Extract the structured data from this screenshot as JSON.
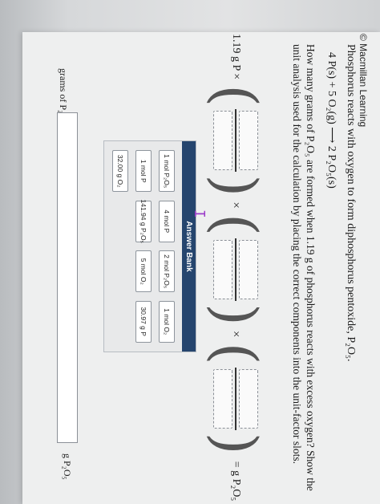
{
  "credit": "© Macmillan Learning",
  "intro": "Phosphorus reacts with oxygen to form diphosphorus pentoxide, P₂O₅.",
  "equation": "4 P(s) + 5 O₂(g) ⟶ 2 P₂O₅(s)",
  "question": "How many grams of P₂O₅ are formed when 1.19 g of phosphorus reacts with excess oxygen? Show the unit analysis used for the calculation by placing the correct components into the unit-factor slots.",
  "calculation": {
    "start": "1.19 g P ×",
    "times": "×",
    "result": "= g P₂O₅"
  },
  "answer_bank": {
    "title": "Answer Bank",
    "tiles": [
      "1 mol P₂O₅",
      "4 mol P",
      "2 mol P₂O₅",
      "1 mol O₂",
      "1 mol P",
      "141.94 g P₂O₅",
      "5 mol O₂",
      "30.97 g P",
      "32.00 g O₂"
    ]
  },
  "answer": {
    "label": "grams of P₂O₅:",
    "value": "",
    "unit": "g P₂O₅"
  }
}
